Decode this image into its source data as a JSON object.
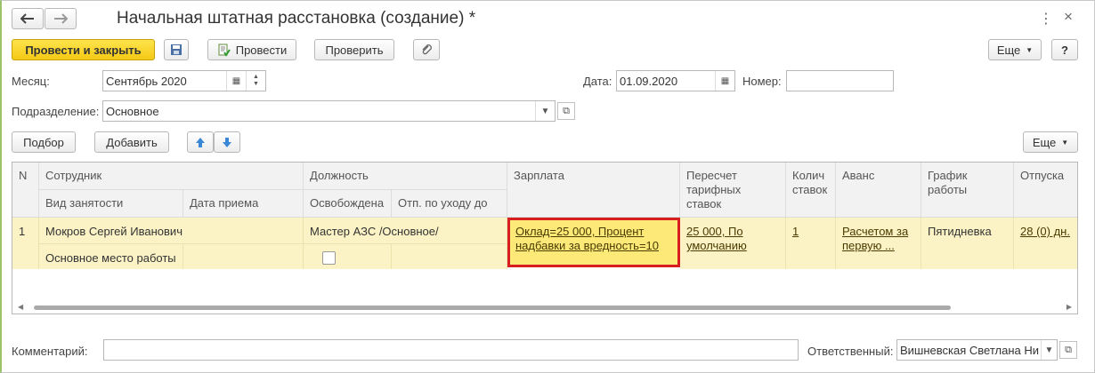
{
  "window": {
    "title": "Начальная штатная расстановка (создание) *",
    "back_icon": "arrow-left-icon",
    "forward_icon": "arrow-right-icon"
  },
  "toolbar": {
    "post_close_label": "Провести и закрыть",
    "post_label": "Провести",
    "check_label": "Проверить",
    "more_label": "Еще",
    "help_label": "?"
  },
  "form": {
    "month_label": "Месяц:",
    "month_value": "Сентябрь 2020",
    "date_label": "Дата:",
    "date_value": "01.09.2020",
    "number_label": "Номер:",
    "number_value": "",
    "division_label": "Подразделение:",
    "division_value": "Основное"
  },
  "table_toolbar": {
    "pick_label": "Подбор",
    "add_label": "Добавить",
    "more_label": "Еще"
  },
  "table": {
    "headers": {
      "n": "N",
      "employee": "Сотрудник",
      "employment_type": "Вид занятости",
      "hire_date": "Дата приема",
      "position": "Должность",
      "released": "Освобождена",
      "leave_until": "Отп. по уходу до",
      "salary": "Зарплата",
      "recalc": "Пересчет тарифных ставок",
      "rates_count": "Колич ставок",
      "advance": "Аванс",
      "schedule": "График работы",
      "vacations": "Отпуска"
    },
    "row": {
      "n": "1",
      "employee": "Мокров Сергей Иванович",
      "employment_type": "Основное место работы",
      "hire_date": "",
      "position": "Мастер АЗС /Основное/",
      "released": false,
      "leave_until": "",
      "salary": "Оклад=25 000, Процент надбавки за вредность=10",
      "recalc": "25 000, По умолчанию",
      "rates_count": "1",
      "advance": "Расчетом за первую ...",
      "schedule": "Пятидневка",
      "vacations": "28 (0) дн."
    }
  },
  "footer": {
    "comment_label": "Комментарий:",
    "comment_value": "",
    "responsible_label": "Ответственный:",
    "responsible_value": "Вишневская Светлана Ни"
  },
  "colors": {
    "accent_yellow": "#f5c915",
    "selected_row": "#fbf3c5",
    "highlight_border": "#d71f1f"
  }
}
